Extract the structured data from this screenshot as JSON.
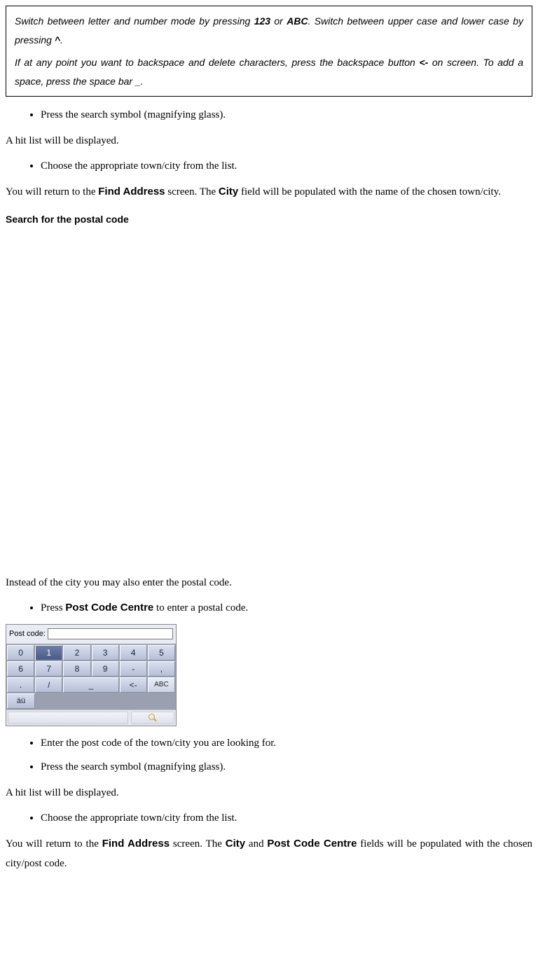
{
  "info_box": {
    "p1_a": "Switch between letter and number mode by pressing ",
    "p1_b1": "123",
    "p1_c": " or ",
    "p1_b2": "ABC",
    "p1_d": ". Switch between upper case and lower case by pressing ",
    "p1_b3": "^",
    "p1_e": ".",
    "p2_a": "If at any point you want to backspace and delete characters, press the backspace button ",
    "p2_b1": "<-",
    "p2_b": " on screen. To add a space, press the space bar ",
    "p2_b2": "_",
    "p2_c": "."
  },
  "sec1": {
    "bullet1": "Press the search symbol (magnifying glass).",
    "para1": "A hit list will be displayed.",
    "bullet2": "Choose the appropriate town/city from the list.",
    "para2_a": "You will return to the ",
    "para2_b1": "Find Address",
    "para2_b": " screen. The ",
    "para2_b2": "City",
    "para2_c": " field will be populated with the name of the chosen town/city."
  },
  "heading": "Search for the postal code",
  "sec2": {
    "para1": "Instead of the city you may also enter the postal code.",
    "bullet1_a": "Press ",
    "bullet1_b": "Post Code Centre",
    "bullet1_c": " to enter a postal code."
  },
  "keypad": {
    "label": "Post code:",
    "value": "",
    "keys_r1": [
      "0",
      "1",
      "2",
      "3",
      "4",
      "5"
    ],
    "keys_r2": [
      "6",
      "7",
      "8",
      "9",
      "-",
      ","
    ],
    "keys_r3": [
      ".",
      "/",
      "_",
      "<-",
      "ABC"
    ],
    "extra": "äü"
  },
  "sec3": {
    "bullet1": "Enter the post code of the town/city you are looking for.",
    "bullet2": "Press the search symbol (magnifying glass).",
    "para1": "A hit list will be displayed.",
    "bullet3": "Choose the appropriate town/city from the list.",
    "para2_a": "You will return to the ",
    "para2_b1": "Find Address",
    "para2_b": " screen. The ",
    "para2_b2": "City",
    "para2_c": " and ",
    "para2_b3": "Post Code Centre",
    "para2_d": " fields will be populated with the chosen city/post code."
  }
}
